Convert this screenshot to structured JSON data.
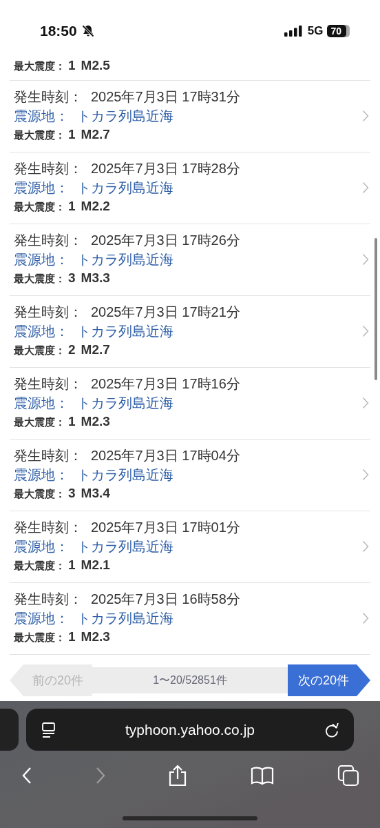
{
  "status_bar": {
    "time": "18:50",
    "silent": true,
    "network": "5G",
    "battery": "70"
  },
  "partial_row": {
    "intensity_label": "最大震度：",
    "intensity": "1",
    "magnitude": "M2.5"
  },
  "rows": [
    {
      "time_label": "発生時刻：",
      "time": "2025年7月3日 17時31分",
      "epicenter_label": "震源地：",
      "epicenter": "トカラ列島近海",
      "intensity_label": "最大震度：",
      "intensity": "1",
      "magnitude": "M2.7"
    },
    {
      "time_label": "発生時刻：",
      "time": "2025年7月3日 17時28分",
      "epicenter_label": "震源地：",
      "epicenter": "トカラ列島近海",
      "intensity_label": "最大震度：",
      "intensity": "1",
      "magnitude": "M2.2"
    },
    {
      "time_label": "発生時刻：",
      "time": "2025年7月3日 17時26分",
      "epicenter_label": "震源地：",
      "epicenter": "トカラ列島近海",
      "intensity_label": "最大震度：",
      "intensity": "3",
      "magnitude": "M3.3"
    },
    {
      "time_label": "発生時刻：",
      "time": "2025年7月3日 17時21分",
      "epicenter_label": "震源地：",
      "epicenter": "トカラ列島近海",
      "intensity_label": "最大震度：",
      "intensity": "2",
      "magnitude": "M2.7"
    },
    {
      "time_label": "発生時刻：",
      "time": "2025年7月3日 17時16分",
      "epicenter_label": "震源地：",
      "epicenter": "トカラ列島近海",
      "intensity_label": "最大震度：",
      "intensity": "1",
      "magnitude": "M2.3"
    },
    {
      "time_label": "発生時刻：",
      "time": "2025年7月3日 17時04分",
      "epicenter_label": "震源地：",
      "epicenter": "トカラ列島近海",
      "intensity_label": "最大震度：",
      "intensity": "3",
      "magnitude": "M3.4"
    },
    {
      "time_label": "発生時刻：",
      "time": "2025年7月3日 17時01分",
      "epicenter_label": "震源地：",
      "epicenter": "トカラ列島近海",
      "intensity_label": "最大震度：",
      "intensity": "1",
      "magnitude": "M2.1"
    },
    {
      "time_label": "発生時刻：",
      "time": "2025年7月3日 16時58分",
      "epicenter_label": "震源地：",
      "epicenter": "トカラ列島近海",
      "intensity_label": "最大震度：",
      "intensity": "1",
      "magnitude": "M2.3"
    }
  ],
  "pagination": {
    "prev": {
      "label": "前の20件",
      "disabled": true
    },
    "info": "1〜20/52851件",
    "next": {
      "label": "次の20件",
      "disabled": false
    }
  },
  "browser": {
    "url": "typhoon.yahoo.co.jp",
    "forward_disabled": true
  }
}
